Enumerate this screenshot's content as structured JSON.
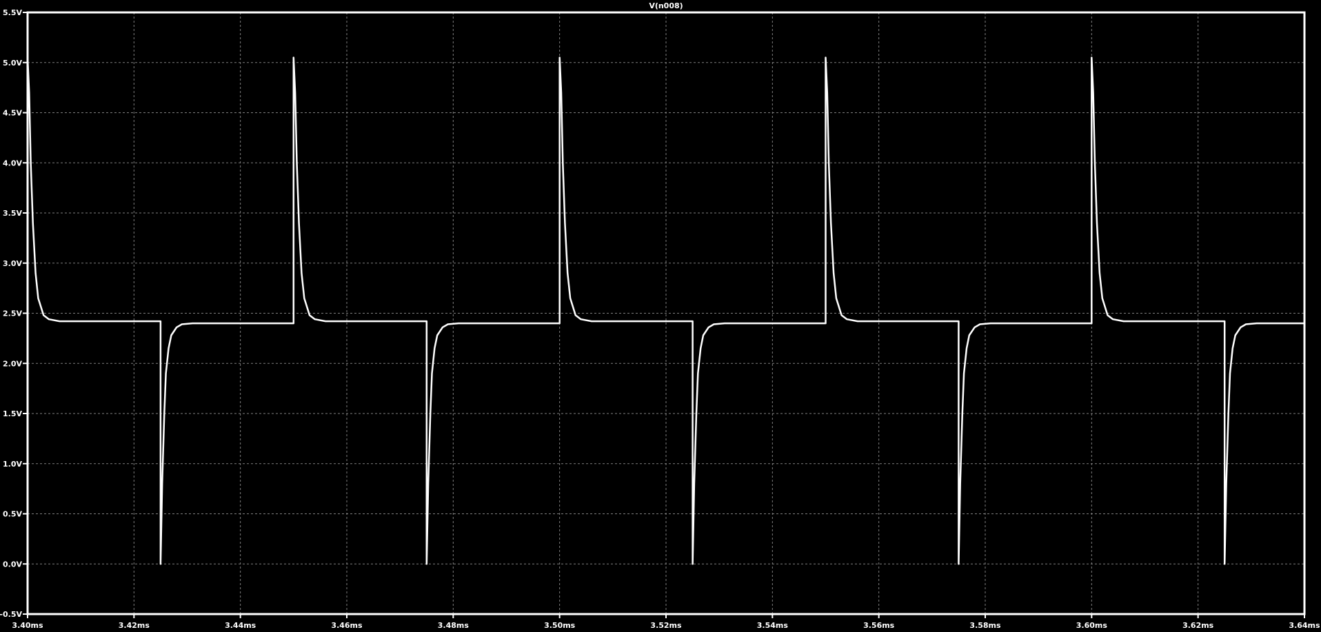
{
  "chart_data": {
    "type": "line",
    "title": "V(n008)",
    "xlabel": "",
    "ylabel": "",
    "xlim": [
      3.4,
      3.64
    ],
    "ylim": [
      -0.5,
      5.5
    ],
    "x_unit": "ms",
    "y_unit": "V",
    "grid": true,
    "background": "#000000",
    "trace_color": "#ffffff",
    "grid_color": "#808080",
    "x_ticks": [
      "3.40ms",
      "3.42ms",
      "3.44ms",
      "3.46ms",
      "3.48ms",
      "3.50ms",
      "3.52ms",
      "3.54ms",
      "3.56ms",
      "3.58ms",
      "3.60ms",
      "3.62ms",
      "3.64ms"
    ],
    "x_tick_values": [
      3.4,
      3.42,
      3.44,
      3.46,
      3.48,
      3.5,
      3.52,
      3.54,
      3.56,
      3.58,
      3.6,
      3.62,
      3.64
    ],
    "y_ticks": [
      "5.5V",
      "5.0V",
      "4.5V",
      "4.0V",
      "3.5V",
      "3.0V",
      "2.5V",
      "2.0V",
      "1.5V",
      "1.0V",
      "0.5V",
      "0.0V",
      "-0.5V"
    ],
    "y_tick_values": [
      5.5,
      5.0,
      4.5,
      4.0,
      3.5,
      3.0,
      2.5,
      2.0,
      1.5,
      1.0,
      0.5,
      0.0,
      -0.5
    ],
    "series": [
      {
        "points": [
          [
            3.4,
            5.05
          ],
          [
            3.4003,
            4.7
          ],
          [
            3.4006,
            4.0
          ],
          [
            3.401,
            3.4
          ],
          [
            3.4015,
            2.9
          ],
          [
            3.402,
            2.65
          ],
          [
            3.403,
            2.48
          ],
          [
            3.404,
            2.44
          ],
          [
            3.406,
            2.42
          ],
          [
            3.425,
            2.42
          ],
          [
            3.425,
            0.0
          ],
          [
            3.4253,
            0.8
          ],
          [
            3.4257,
            1.5
          ],
          [
            3.426,
            1.9
          ],
          [
            3.4265,
            2.15
          ],
          [
            3.427,
            2.28
          ],
          [
            3.428,
            2.36
          ],
          [
            3.429,
            2.39
          ],
          [
            3.431,
            2.4
          ],
          [
            3.45,
            2.4
          ],
          [
            3.45,
            5.05
          ],
          [
            3.4503,
            4.7
          ],
          [
            3.4506,
            4.0
          ],
          [
            3.451,
            3.4
          ],
          [
            3.4515,
            2.9
          ],
          [
            3.452,
            2.65
          ],
          [
            3.453,
            2.48
          ],
          [
            3.454,
            2.44
          ],
          [
            3.456,
            2.42
          ],
          [
            3.475,
            2.42
          ],
          [
            3.475,
            0.0
          ],
          [
            3.4753,
            0.8
          ],
          [
            3.4757,
            1.5
          ],
          [
            3.476,
            1.9
          ],
          [
            3.4765,
            2.15
          ],
          [
            3.477,
            2.28
          ],
          [
            3.478,
            2.36
          ],
          [
            3.479,
            2.39
          ],
          [
            3.481,
            2.4
          ],
          [
            3.5,
            2.4
          ],
          [
            3.5,
            5.05
          ],
          [
            3.5003,
            4.7
          ],
          [
            3.5006,
            4.0
          ],
          [
            3.501,
            3.4
          ],
          [
            3.5015,
            2.9
          ],
          [
            3.502,
            2.65
          ],
          [
            3.503,
            2.48
          ],
          [
            3.504,
            2.44
          ],
          [
            3.506,
            2.42
          ],
          [
            3.525,
            2.42
          ],
          [
            3.525,
            0.0
          ],
          [
            3.5253,
            0.8
          ],
          [
            3.5257,
            1.5
          ],
          [
            3.526,
            1.9
          ],
          [
            3.5265,
            2.15
          ],
          [
            3.527,
            2.28
          ],
          [
            3.528,
            2.36
          ],
          [
            3.529,
            2.39
          ],
          [
            3.531,
            2.4
          ],
          [
            3.55,
            2.4
          ],
          [
            3.55,
            5.05
          ],
          [
            3.5503,
            4.7
          ],
          [
            3.5506,
            4.0
          ],
          [
            3.551,
            3.4
          ],
          [
            3.5515,
            2.9
          ],
          [
            3.552,
            2.65
          ],
          [
            3.553,
            2.48
          ],
          [
            3.554,
            2.44
          ],
          [
            3.556,
            2.42
          ],
          [
            3.575,
            2.42
          ],
          [
            3.575,
            0.0
          ],
          [
            3.5753,
            0.8
          ],
          [
            3.5757,
            1.5
          ],
          [
            3.576,
            1.9
          ],
          [
            3.5765,
            2.15
          ],
          [
            3.577,
            2.28
          ],
          [
            3.578,
            2.36
          ],
          [
            3.579,
            2.39
          ],
          [
            3.581,
            2.4
          ],
          [
            3.6,
            2.4
          ],
          [
            3.6,
            5.05
          ],
          [
            3.6003,
            4.7
          ],
          [
            3.6006,
            4.0
          ],
          [
            3.601,
            3.4
          ],
          [
            3.6015,
            2.9
          ],
          [
            3.602,
            2.65
          ],
          [
            3.603,
            2.48
          ],
          [
            3.604,
            2.44
          ],
          [
            3.606,
            2.42
          ],
          [
            3.625,
            2.42
          ],
          [
            3.625,
            0.0
          ],
          [
            3.6253,
            0.8
          ],
          [
            3.6257,
            1.5
          ],
          [
            3.626,
            1.9
          ],
          [
            3.6265,
            2.15
          ],
          [
            3.627,
            2.28
          ],
          [
            3.628,
            2.36
          ],
          [
            3.629,
            2.39
          ],
          [
            3.631,
            2.4
          ],
          [
            3.64,
            2.4
          ]
        ]
      }
    ]
  }
}
